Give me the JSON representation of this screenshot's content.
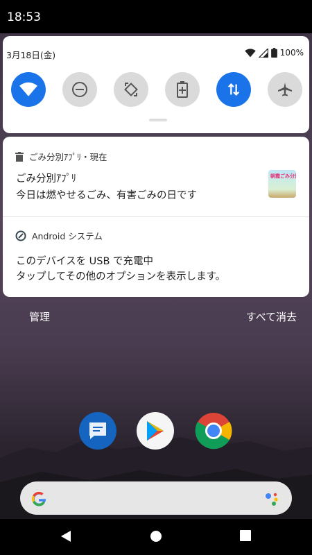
{
  "status_bar": {
    "time": "18:53"
  },
  "quick_settings": {
    "date": "3月18日(金)",
    "battery": "100%",
    "tiles": [
      {
        "name": "wifi",
        "on": true
      },
      {
        "name": "do-not-disturb",
        "on": false
      },
      {
        "name": "auto-rotate",
        "on": false
      },
      {
        "name": "battery-saver",
        "on": false
      },
      {
        "name": "mobile-data",
        "on": true
      },
      {
        "name": "airplane-mode",
        "on": false
      }
    ]
  },
  "notifications": [
    {
      "header": "ごみ分別ｱﾌﾟﾘ・現在",
      "title": "ごみ分別ｱﾌﾟﾘ",
      "text": "今日は燃やせるごみ、有害ごみの日です",
      "thumb_text": "朝霞ごみ分別"
    },
    {
      "header": "Android システム",
      "title": "このデバイスを USB で充電中",
      "text": "タップしてその他のオプションを表示します。"
    }
  ],
  "actions": {
    "manage": "管理",
    "clear_all": "すべて消去"
  },
  "dock": [
    "Messages",
    "Play Store",
    "Chrome"
  ],
  "colors": {
    "accent": "#1a73e8",
    "tile_off": "#dadada"
  }
}
